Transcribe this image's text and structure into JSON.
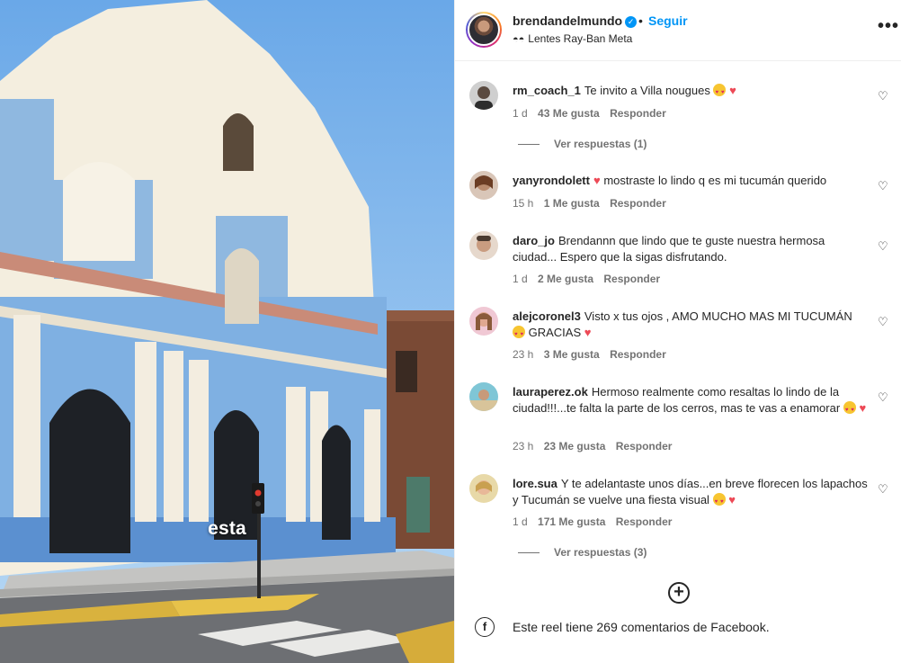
{
  "media": {
    "caption": "esta"
  },
  "header": {
    "username": "brendandelmundo",
    "separator": "•",
    "follow_label": "Seguir",
    "subtitle": "Lentes Ray-Ban Meta",
    "more_icon": "more-icon"
  },
  "comments": [
    {
      "username": "rm_coach_1",
      "text": "Te invito a Villa nougues",
      "time": "1 d",
      "likes": "43 Me gusta",
      "reply": "Responder",
      "replies": "Ver respuestas (1)"
    },
    {
      "username": "yanyrondolett",
      "text": "mostraste lo lindo q es mi tucumán querido",
      "time": "15 h",
      "likes": "1 Me gusta",
      "reply": "Responder"
    },
    {
      "username": "daro_jo",
      "text": "Brendannn que lindo que te guste nuestra hermosa ciudad... Espero que la sigas disfrutando.",
      "time": "1 d",
      "likes": "2 Me gusta",
      "reply": "Responder"
    },
    {
      "username": "alejcoronel3",
      "text": "Visto x tus ojos , AMO MUCHO MAS MI TUCUMÁN",
      "text_after": "GRACIAS",
      "time": "23 h",
      "likes": "3 Me gusta",
      "reply": "Responder"
    },
    {
      "username": "lauraperez.ok",
      "text": "Hermoso realmente como resaltas lo lindo de la ciudad!!!...te falta la parte de los cerros, mas te vas a enamorar",
      "time": "23 h",
      "likes": "23 Me gusta",
      "reply": "Responder"
    },
    {
      "username": "lore.sua",
      "text": "Y te adelantaste unos días...en breve florecen los lapachos y Tucumán se vuelve una fiesta visual",
      "time": "1 d",
      "likes": "171 Me gusta",
      "reply": "Responder",
      "replies": "Ver respuestas (3)"
    }
  ],
  "footer": {
    "facebook_text": "Este reel tiene 269 comentarios de Facebook.",
    "facebook_icon_glyph": "f"
  },
  "colors": {
    "accent": "#0095f6",
    "heart": "#ed4956",
    "muted": "#737373"
  }
}
